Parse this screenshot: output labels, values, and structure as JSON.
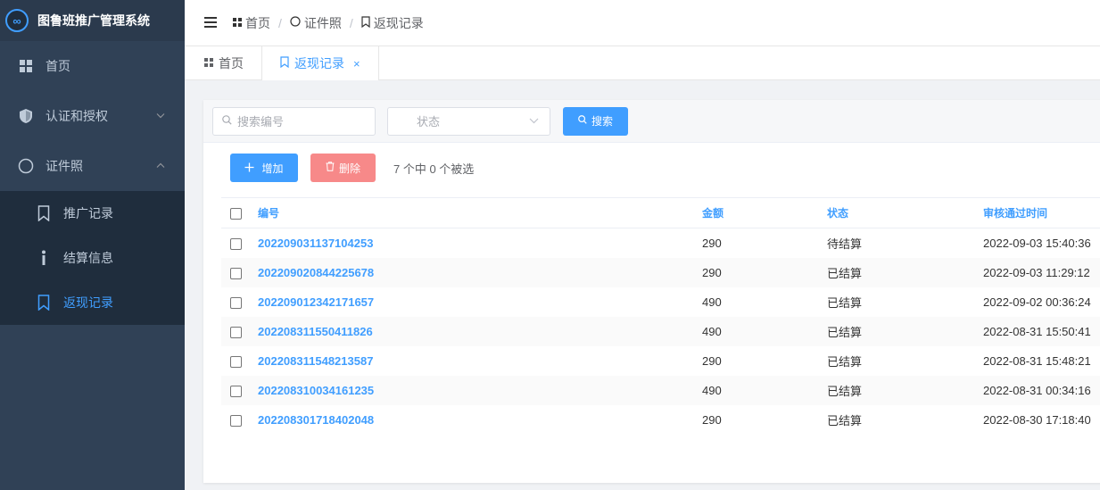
{
  "app": {
    "title": "图鲁班推广管理系统",
    "logo_glyph": "∞",
    "accent": "#409eff"
  },
  "sidebar": {
    "items": [
      {
        "label": "首页",
        "icon": "dashboard-icon"
      },
      {
        "label": "认证和授权",
        "icon": "shield-icon",
        "arrow": "chevron-down-icon"
      },
      {
        "label": "证件照",
        "icon": "circle-icon",
        "arrow": "chevron-up-icon"
      }
    ],
    "submenu": [
      {
        "label": "推广记录",
        "icon": "bookmark-icon"
      },
      {
        "label": "结算信息",
        "icon": "info-icon"
      },
      {
        "label": "返现记录",
        "icon": "bookmark-icon",
        "active": true
      }
    ]
  },
  "navbar": {
    "breadcrumb": [
      "首页",
      "证件照",
      "返现记录"
    ],
    "separator": "/"
  },
  "tags": {
    "home": "首页",
    "active": "返现记录",
    "close": "×"
  },
  "filters": {
    "search_placeholder": "搜索编号",
    "status_placeholder": "状态",
    "search_button": "搜索"
  },
  "actions": {
    "add": "增加",
    "delete": "删除",
    "selection_info": "7 个中 0 个被选"
  },
  "table": {
    "headers": {
      "number": "编号",
      "amount": "金额",
      "status": "状态",
      "time": "审核通过时间"
    },
    "rows": [
      {
        "number": "202209031137104253",
        "amount": "290",
        "status": "待结算",
        "time": "2022-09-03 15:40:36"
      },
      {
        "number": "202209020844225678",
        "amount": "290",
        "status": "已结算",
        "time": "2022-09-03 11:29:12"
      },
      {
        "number": "202209012342171657",
        "amount": "490",
        "status": "已结算",
        "time": "2022-09-02 00:36:24"
      },
      {
        "number": "202208311550411826",
        "amount": "490",
        "status": "已结算",
        "time": "2022-08-31 15:50:41"
      },
      {
        "number": "202208311548213587",
        "amount": "290",
        "status": "已结算",
        "time": "2022-08-31 15:48:21"
      },
      {
        "number": "202208310034161235",
        "amount": "490",
        "status": "已结算",
        "time": "2022-08-31 00:34:16"
      },
      {
        "number": "202208301718402048",
        "amount": "290",
        "status": "已结算",
        "time": "2022-08-30 17:18:40"
      }
    ]
  }
}
